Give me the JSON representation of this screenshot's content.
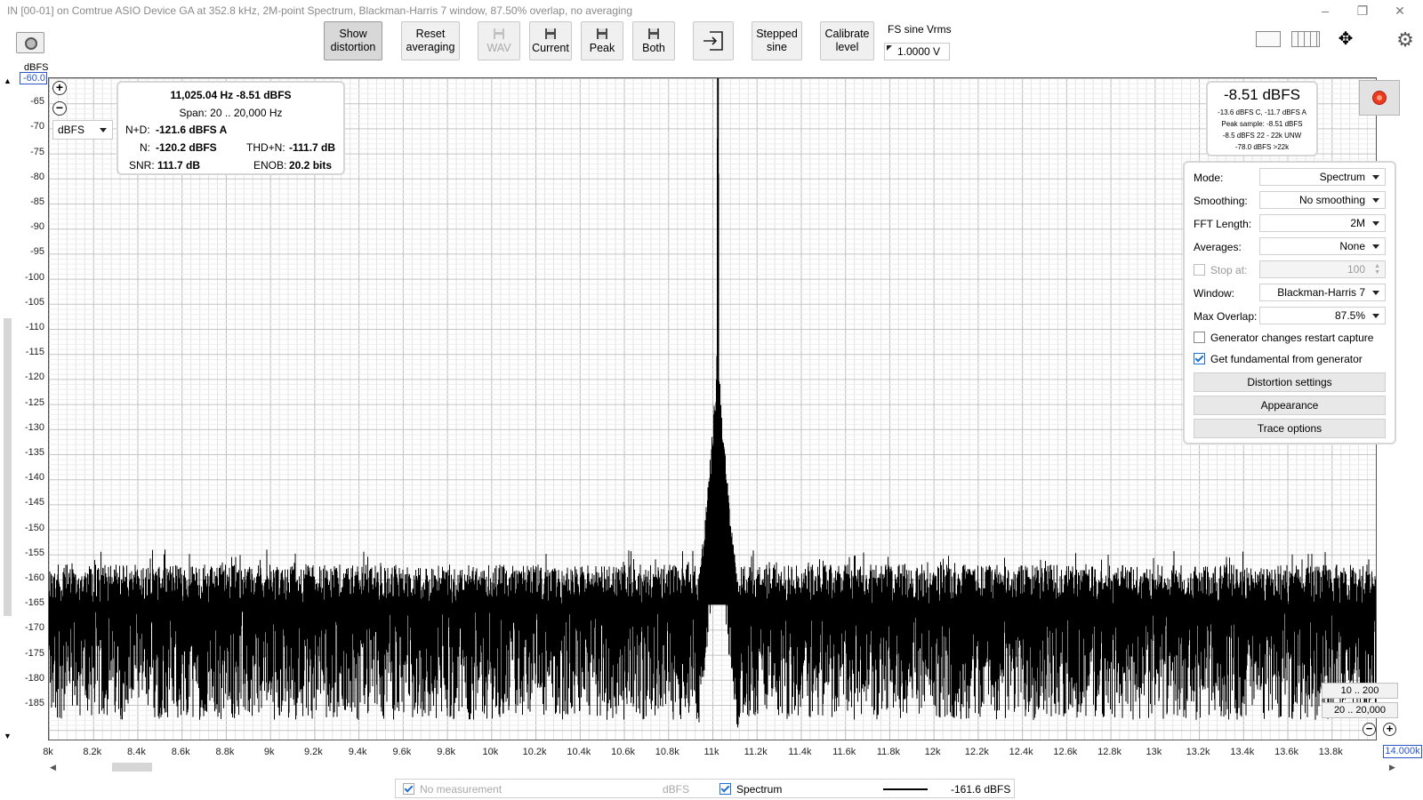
{
  "window": {
    "title": "IN [00-01] on Comtrue ASIO Device GA at 352.8 kHz, 2M-point Spectrum, Blackman-Harris 7 window, 87.50% overlap, no averaging",
    "minimize": "–",
    "maximize": "❐",
    "close": "✕"
  },
  "toolbar": {
    "show_distortion": [
      "Show",
      "distortion"
    ],
    "reset_averaging": [
      "Reset",
      "averaging"
    ],
    "wav": "WAV",
    "current": "Current",
    "peak": "Peak",
    "both": "Both",
    "stepped_sine": [
      "Stepped",
      "sine"
    ],
    "calibrate_level": [
      "Calibrate",
      "level"
    ],
    "fs_sine_label": "FS sine Vrms",
    "fs_sine_value": "1.0000 V"
  },
  "yaxis": {
    "unit": "dBFS",
    "top_value": "-60.0",
    "ticks": [
      "-65",
      "-70",
      "-75",
      "-80",
      "-85",
      "-90",
      "-95",
      "-100",
      "-105",
      "-110",
      "-115",
      "-120",
      "-125",
      "-130",
      "-135",
      "-140",
      "-145",
      "-150",
      "-155",
      "-160",
      "-165",
      "-170",
      "-175",
      "-180",
      "-185"
    ],
    "unit_select": "dBFS"
  },
  "xaxis": {
    "ticks": [
      "8k",
      "8.2k",
      "8.4k",
      "8.6k",
      "8.8k",
      "9k",
      "9.2k",
      "9.4k",
      "9.6k",
      "9.8k",
      "10k",
      "10.2k",
      "10.4k",
      "10.6k",
      "10.8k",
      "11k",
      "11.2k",
      "11.4k",
      "11.6k",
      "11.8k",
      "12k",
      "12.2k",
      "12.4k",
      "12.6k",
      "12.8k",
      "13k",
      "13.2k",
      "13.4k",
      "13.6k",
      "13.8k"
    ],
    "end_value": "14.000k"
  },
  "chart_data": {
    "type": "line",
    "xlabel": "",
    "ylabel": "dBFS",
    "xlim": [
      8000,
      14000
    ],
    "ylim": [
      -188,
      -60
    ],
    "grid": true,
    "series": [
      {
        "name": "Spectrum",
        "color": "#000000",
        "peak": {
          "x": 11025.04,
          "y": -8.51
        },
        "noise_floor_upper": -157,
        "noise_floor_lower": -188,
        "skirt": [
          [
            10925,
            -165
          ],
          [
            10960,
            -155
          ],
          [
            10990,
            -140
          ],
          [
            11010,
            -128
          ],
          [
            11020,
            -121
          ],
          [
            11025,
            -8.51
          ],
          [
            11030,
            -121
          ],
          [
            11040,
            -128
          ],
          [
            11060,
            -140
          ],
          [
            11090,
            -155
          ],
          [
            11125,
            -165
          ]
        ]
      }
    ]
  },
  "readout": {
    "line1": "11,025.04 Hz  -8.51 dBFS",
    "span": "Span: 20 .. 20,000 Hz",
    "nd_label": "N+D:",
    "nd_value": "-121.6 dBFS A",
    "n_label": "N:",
    "n_value": "-120.2 dBFS",
    "thdn_label": "THD+N:",
    "thdn_value": "-111.7 dB",
    "snr_label": "SNR:",
    "snr_value": "111.7 dB",
    "enob_label": "ENOB:",
    "enob_value": "20.2 bits"
  },
  "level": {
    "main": "-8.51 dBFS",
    "l1": "-13.6 dBFS C, -11.7 dBFS A",
    "l2": "Peak sample: -8.51 dBFS",
    "l3": "-8.5 dBFS 22 - 22k UNW",
    "l4": "-78.0 dBFS >22k"
  },
  "settings": {
    "mode_label": "Mode:",
    "mode": "Spectrum",
    "smoothing_label": "Smoothing:",
    "smoothing": "No smoothing",
    "fft_label": "FFT Length:",
    "fft": "2M",
    "averages_label": "Averages:",
    "averages": "None",
    "stop_label": "Stop at:",
    "stop": "100",
    "window_label": "Window:",
    "window": "Blackman-Harris 7",
    "overlap_label": "Max Overlap:",
    "overlap": "87.5%",
    "gen_restart": "Generator changes restart capture",
    "gen_fund": "Get fundamental from generator",
    "distortion_settings": "Distortion settings",
    "appearance": "Appearance",
    "trace_options": "Trace options"
  },
  "range_buttons": {
    "r1": "10 .. 200",
    "r2": "20 .. 20,000"
  },
  "legend": {
    "no_measurement": "No measurement",
    "unit": "dBFS",
    "spectrum": "Spectrum",
    "value": "-161.6 dBFS"
  }
}
